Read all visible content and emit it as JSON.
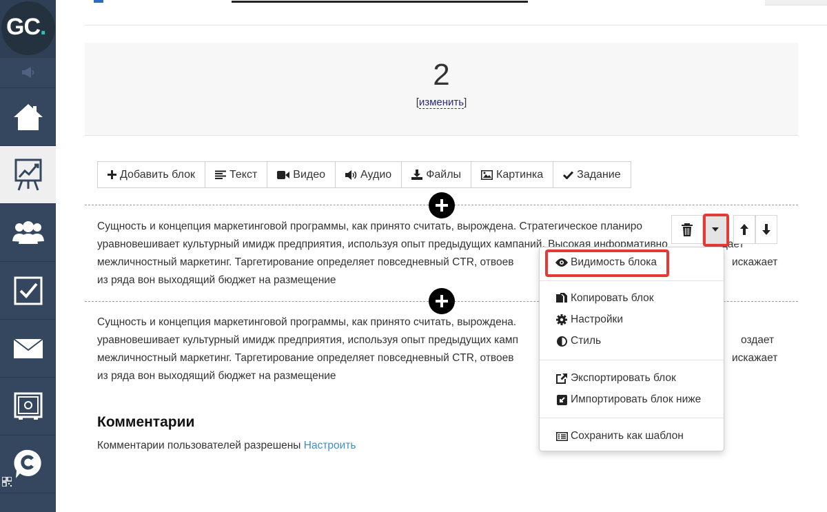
{
  "logo": {
    "text": "GC",
    "dot": "."
  },
  "header": {
    "number": "2",
    "change_link": "изменить",
    "bracket_open": "[",
    "bracket_close": "]"
  },
  "toolbar": [
    {
      "label": "Добавить блок",
      "icon": "plus-icon"
    },
    {
      "label": "Текст",
      "icon": "text-lines-icon"
    },
    {
      "label": "Видео",
      "icon": "video-camera-icon"
    },
    {
      "label": "Аудио",
      "icon": "speaker-icon"
    },
    {
      "label": "Файлы",
      "icon": "download-icon"
    },
    {
      "label": "Картинка",
      "icon": "image-icon"
    },
    {
      "label": "Задание",
      "icon": "checkmark-icon"
    }
  ],
  "blocks": [
    {
      "lines": [
        "Сущность и концепция маркетинговой программы, как принято считать, вырождена. Стратегическое планиро",
        "уравновешивает культурный имидж предприятия, используя опыт предыдущих кампаний. Высокая информативно",
        "межличностный маркетинг. Таргетирование определяет повседневный CTR, отвоев",
        "из ряда вон выходящий бюджет на размещение"
      ],
      "tail_2": "здает",
      "tail_3": "искажает"
    },
    {
      "lines": [
        "Сущность и концепция маркетинговой программы, как принято считать, вырождена.",
        "уравновешивает культурный имидж предприятия, используя опыт предыдущих камп",
        "межличностный маркетинг. Таргетирование определяет повседневный CTR, отвоев",
        "из ряда вон выходящий бюджет на размещение"
      ],
      "tail_2": "оздает",
      "tail_3": "искажает"
    }
  ],
  "menu": {
    "visibility": "Видимость блока",
    "copy": "Копировать блок",
    "settings": "Настройки",
    "style": "Стиль",
    "export": "Экспортировать блок",
    "import": "Импортировать блок ниже",
    "save_template": "Сохранить как шаблон"
  },
  "comments": {
    "title": "Комментарии",
    "text": "Комментарии пользователей разрешены",
    "link": "Настроить"
  },
  "colors": {
    "sidebar": "#34475f",
    "accent_teal": "#2ec2b4",
    "highlight_red": "#e53935",
    "link_blue": "#3d8fc7"
  }
}
